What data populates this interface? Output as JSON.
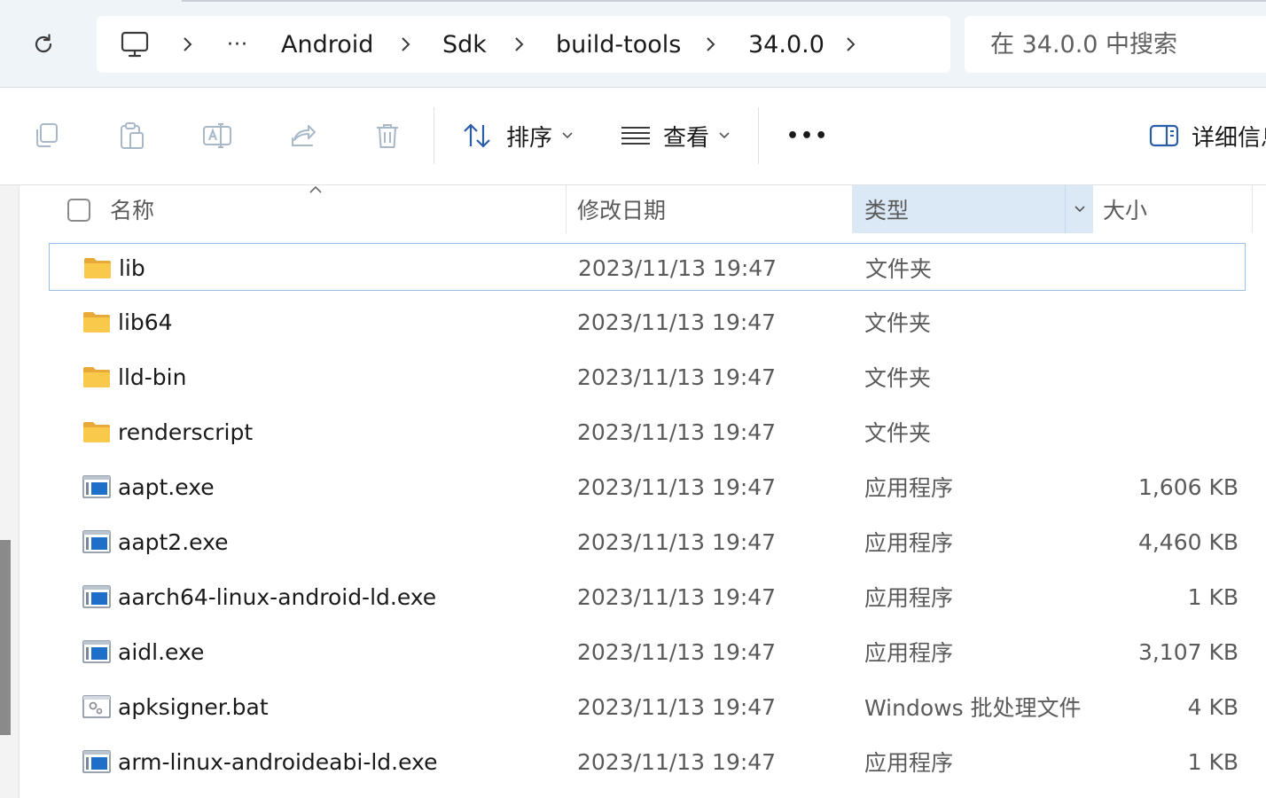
{
  "breadcrumb": {
    "items": [
      {
        "label": "Android"
      },
      {
        "label": "Sdk"
      },
      {
        "label": "build-tools"
      },
      {
        "label": "34.0.0"
      }
    ],
    "overflow": "···"
  },
  "search": {
    "placeholder": "在 34.0.0 中搜索"
  },
  "toolbar": {
    "sort_label": "排序",
    "view_label": "查看",
    "more_label": "•••",
    "details_label": "详细信息"
  },
  "columns": {
    "name": "名称",
    "modified": "修改日期",
    "type": "类型",
    "size": "大小"
  },
  "files": [
    {
      "name": "lib",
      "modified": "2023/11/13 19:47",
      "type": "文件夹",
      "size": "",
      "icon": "folder-icon"
    },
    {
      "name": "lib64",
      "modified": "2023/11/13 19:47",
      "type": "文件夹",
      "size": "",
      "icon": "folder-icon"
    },
    {
      "name": "lld-bin",
      "modified": "2023/11/13 19:47",
      "type": "文件夹",
      "size": "",
      "icon": "folder-icon"
    },
    {
      "name": "renderscript",
      "modified": "2023/11/13 19:47",
      "type": "文件夹",
      "size": "",
      "icon": "folder-icon"
    },
    {
      "name": "aapt.exe",
      "modified": "2023/11/13 19:47",
      "type": "应用程序",
      "size": "1,606 KB",
      "icon": "exe-icon"
    },
    {
      "name": "aapt2.exe",
      "modified": "2023/11/13 19:47",
      "type": "应用程序",
      "size": "4,460 KB",
      "icon": "exe-icon"
    },
    {
      "name": "aarch64-linux-android-ld.exe",
      "modified": "2023/11/13 19:47",
      "type": "应用程序",
      "size": "1 KB",
      "icon": "exe-icon"
    },
    {
      "name": "aidl.exe",
      "modified": "2023/11/13 19:47",
      "type": "应用程序",
      "size": "3,107 KB",
      "icon": "exe-icon"
    },
    {
      "name": "apksigner.bat",
      "modified": "2023/11/13 19:47",
      "type": "Windows 批处理文件",
      "size": "4 KB",
      "icon": "bat-icon"
    },
    {
      "name": "arm-linux-androideabi-ld.exe",
      "modified": "2023/11/13 19:47",
      "type": "应用程序",
      "size": "1 KB",
      "icon": "exe-icon"
    }
  ],
  "colors": {
    "selection_border": "#99c1e8",
    "header_highlight": "#dbe9f7",
    "folder_yellow": "#f8c94a",
    "exe_blue": "#1e6fc9"
  }
}
